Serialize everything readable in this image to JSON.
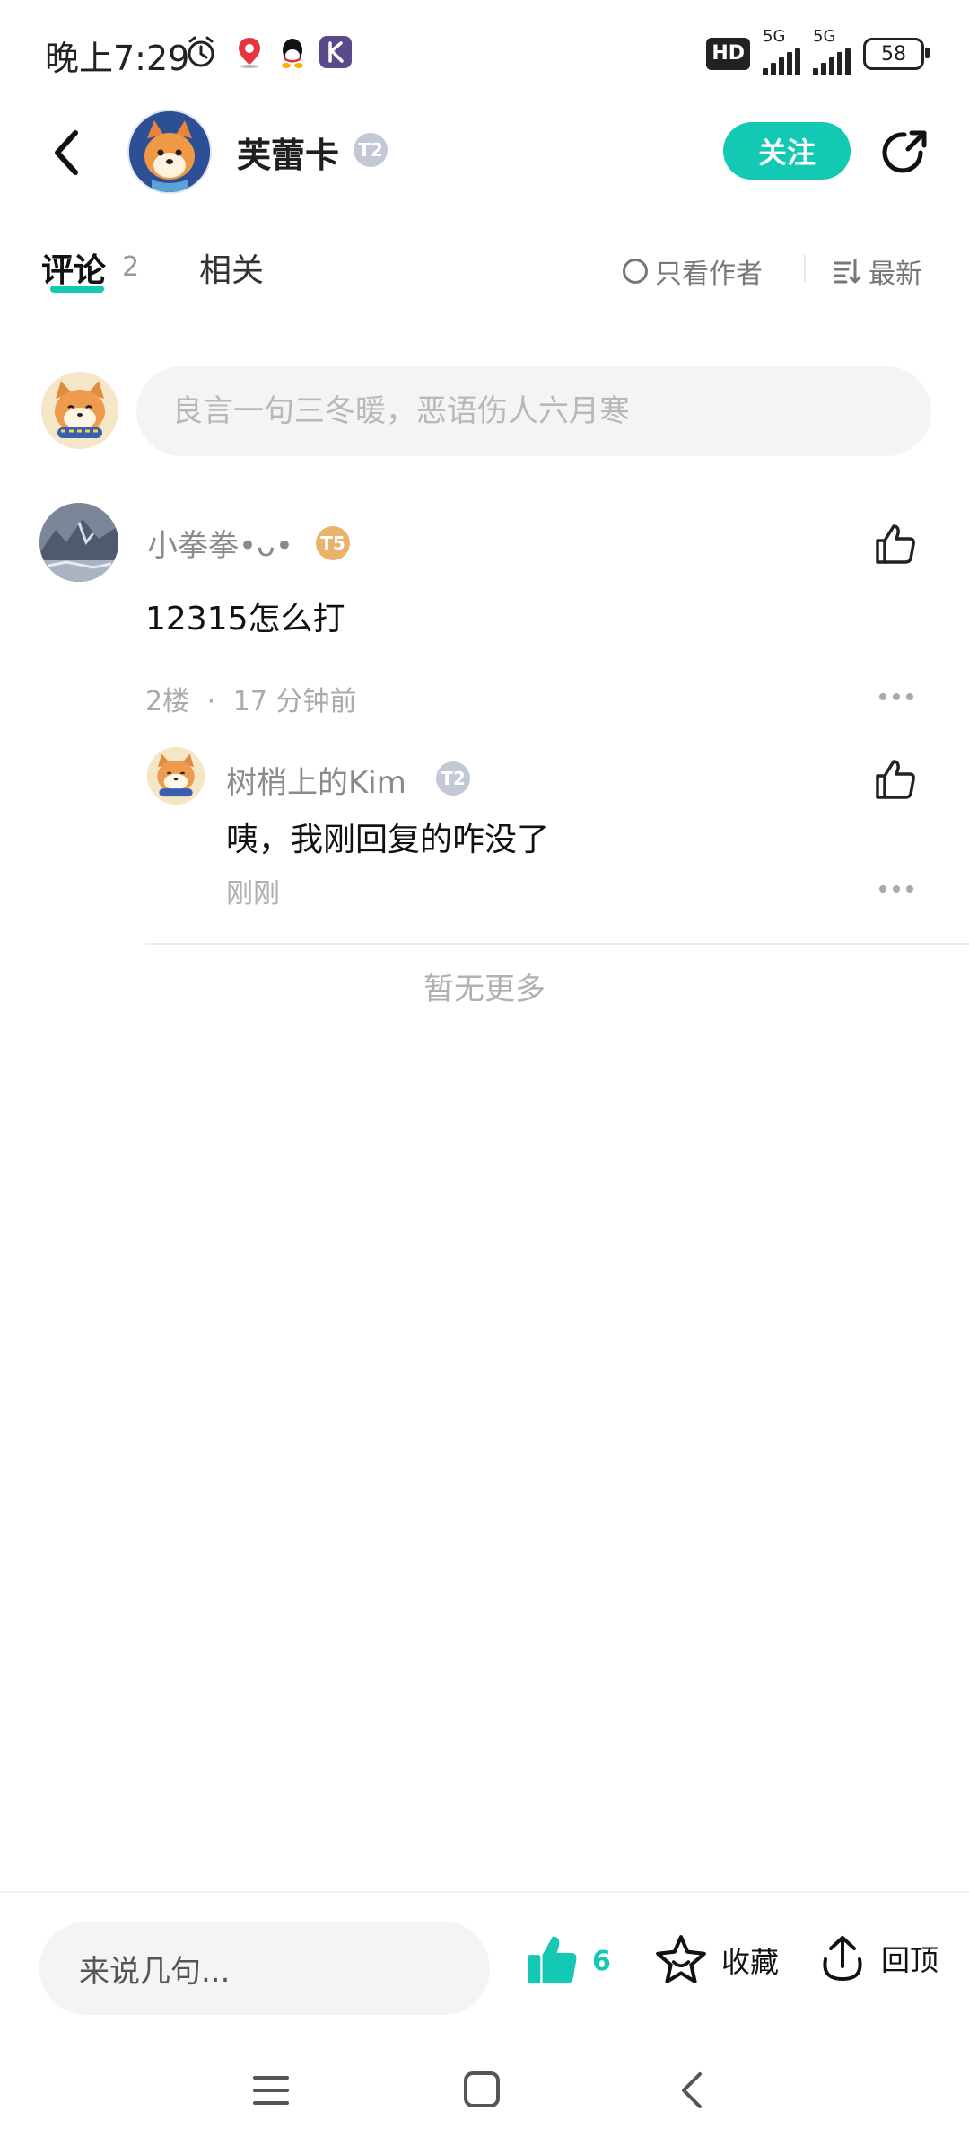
{
  "status_bar": {
    "time": "晚上7:29",
    "hd_label": "HD",
    "sim1_label": "5G",
    "sim2_label": "5G",
    "battery": "58",
    "icons": [
      "alarm-icon",
      "map-pin-icon",
      "qq-icon",
      "k-app-icon"
    ]
  },
  "header": {
    "author_name": "芙蕾卡",
    "author_level": "T2",
    "follow_label": "关注"
  },
  "tabs": {
    "comments_label": "评论",
    "comments_count": "2",
    "related_label": "相关",
    "only_author_label": "只看作者",
    "sort_label": "最新"
  },
  "composer": {
    "placeholder": "良言一句三冬暖，恶语伤人六月寒"
  },
  "comments": [
    {
      "user": "小拳拳•ᴗ•",
      "level": "T5",
      "text": "12315怎么打",
      "floor": "2楼",
      "time": "17 分钟前",
      "replies": [
        {
          "user": "树梢上的Kim",
          "level": "T2",
          "text": "咦，我刚回复的咋没了",
          "time": "刚刚"
        }
      ]
    }
  ],
  "footer_note": "暂无更多",
  "bottom_bar": {
    "input_placeholder": "来说几句...",
    "like_count": "6",
    "favorite_label": "收藏",
    "back_top_label": "回顶"
  },
  "colors": {
    "accent": "#14c9b4",
    "gold_badge": "#e9b36b",
    "silver_badge": "#c2c8d6"
  }
}
